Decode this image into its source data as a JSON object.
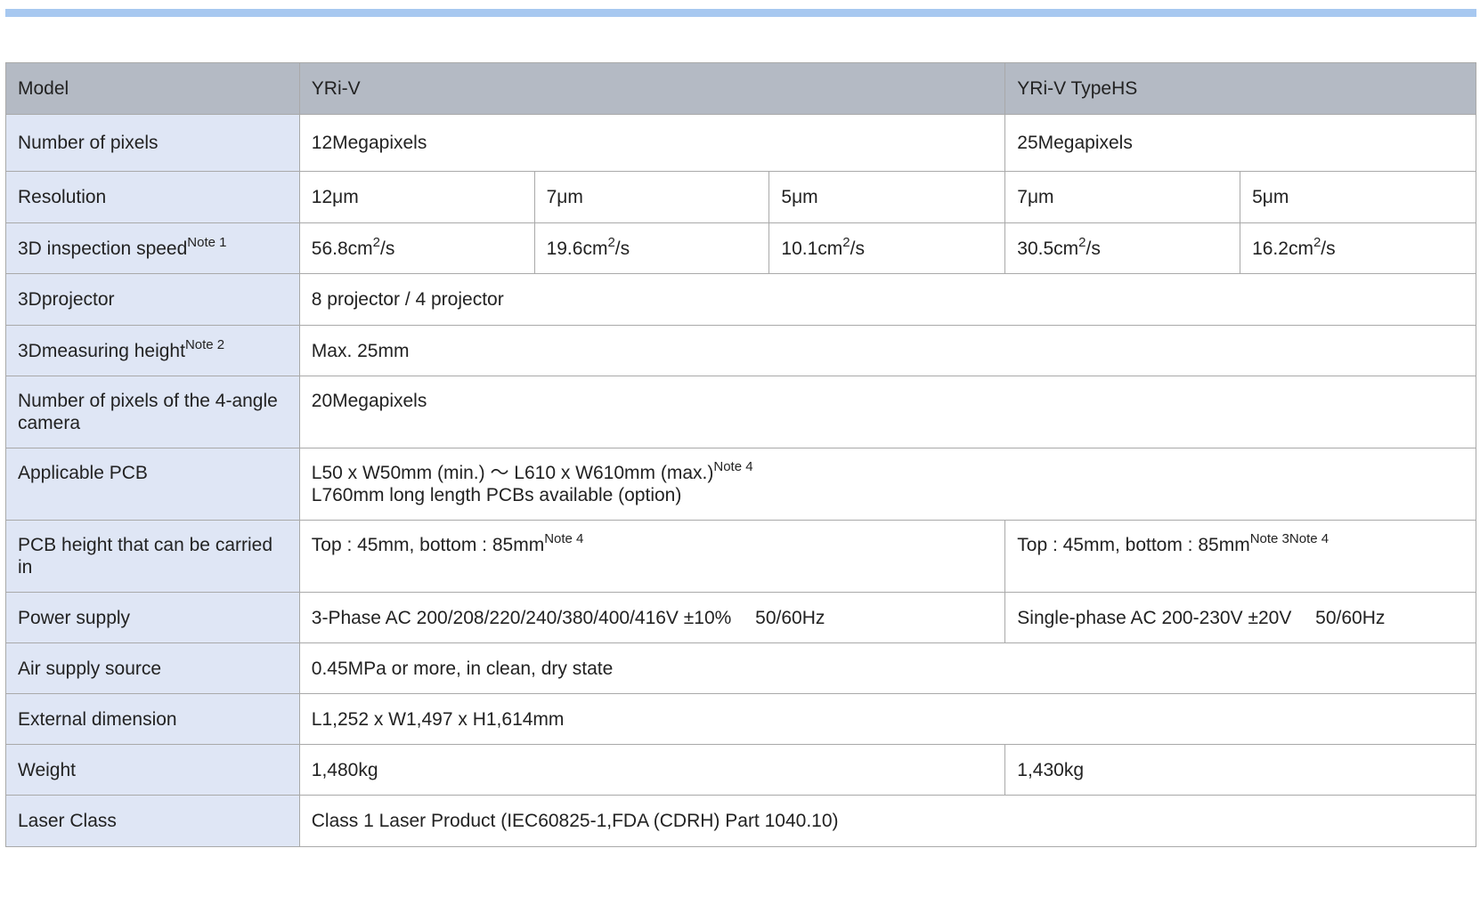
{
  "table": {
    "header": {
      "label": "Model",
      "col1": "YRi-V",
      "col2": "YRi-V TypeHS"
    },
    "rows": {
      "pixels": {
        "label": "Number of pixels",
        "v1": "12Megapixels",
        "v2": "25Megapixels"
      },
      "resolution": {
        "label": "Resolution",
        "values": [
          "12μm",
          "7μm",
          "5μm",
          "7μm",
          "5μm"
        ]
      },
      "speed": {
        "label": "3D inspection speed",
        "note": "Note 1",
        "values": [
          "56.8cm",
          "19.6cm",
          "10.1cm",
          "30.5cm",
          "16.2cm"
        ],
        "exp": "2",
        "unit_tail": "/s"
      },
      "projector": {
        "label": "3Dprojector",
        "value": "8 projector / 4 projector"
      },
      "height": {
        "label": "3Dmeasuring height",
        "note": "Note 2",
        "value": "Max. 25mm"
      },
      "camera": {
        "label": "Number of pixels of the 4-angle camera",
        "value": "20Megapixels"
      },
      "pcb": {
        "label": "Applicable PCB",
        "line1": "L50 x W50mm (min.) ～ L610 x W610mm (max.)",
        "line1_note": "Note 4",
        "line2": "L760mm long length PCBs available (option)"
      },
      "carry": {
        "label": "PCB height that can be carried in",
        "v1": "Top : 45mm, bottom : 85mm",
        "v1_note": "Note 4",
        "v2": "Top : 45mm, bottom : 85mm",
        "v2_note": "Note 3Note 4"
      },
      "power": {
        "label": "Power supply",
        "v1": "3-Phase AC 200/208/220/240/380/400/416V ±10%　 50/60Hz",
        "v2": "Single-phase AC 200-230V ±20V　 50/60Hz"
      },
      "air": {
        "label": "Air supply source",
        "value": "0.45MPa or more, in clean, dry state"
      },
      "dimension": {
        "label": "External dimension",
        "value": "L1,252 x W1,497 x H1,614mm"
      },
      "weight": {
        "label": "Weight",
        "v1": "1,480kg",
        "v2": "1,430kg"
      },
      "laser": {
        "label": "Laser Class",
        "value": "Class 1 Laser Product (IEC60825-1,FDA (CDRH) Part 1040.10)"
      }
    }
  },
  "colors": {
    "top_bar": "#a7c8f0",
    "header_bg": "#b4bac4",
    "label_bg": "#dfe6f5",
    "border": "#a9a9a9"
  }
}
